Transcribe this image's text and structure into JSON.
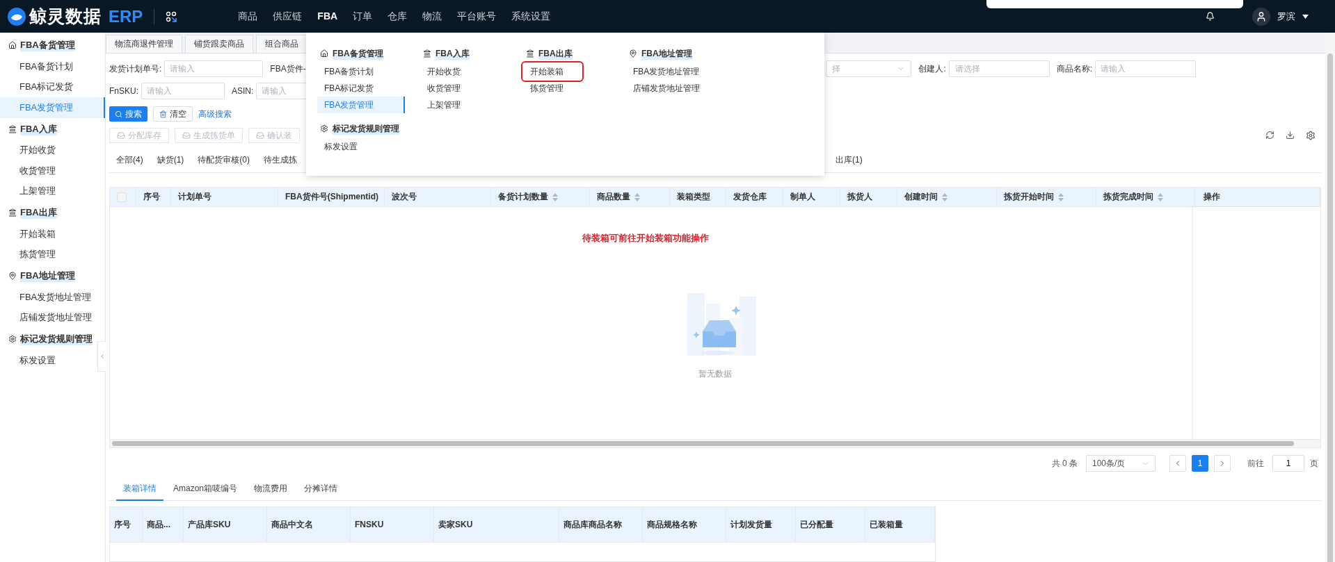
{
  "app": {
    "logo": "鲸灵数据",
    "logo_suffix": "ERP"
  },
  "top_nav": [
    {
      "label": "商品",
      "selected": false
    },
    {
      "label": "供应链",
      "selected": false
    },
    {
      "label": "FBA",
      "selected": true
    },
    {
      "label": "订单",
      "selected": false
    },
    {
      "label": "仓库",
      "selected": false
    },
    {
      "label": "物流",
      "selected": false
    },
    {
      "label": "平台账号",
      "selected": false
    },
    {
      "label": "系统设置",
      "selected": false
    }
  ],
  "user": {
    "name": "罗滨"
  },
  "sidebar": [
    {
      "title": "FBA备货管理",
      "kind": "home",
      "items": [
        {
          "label": "FBA备货计划",
          "selected": false
        },
        {
          "label": "FBA标记发货",
          "selected": false
        },
        {
          "label": "FBA发货管理",
          "selected": true
        }
      ]
    },
    {
      "title": "FBA入库",
      "kind": "bank",
      "items": [
        {
          "label": "开始收货",
          "selected": false
        },
        {
          "label": "收货管理",
          "selected": false
        },
        {
          "label": "上架管理",
          "selected": false
        }
      ]
    },
    {
      "title": "FBA出库",
      "kind": "bank",
      "items": [
        {
          "label": "开始装箱",
          "selected": false
        },
        {
          "label": "拣货管理",
          "selected": false
        }
      ]
    },
    {
      "title": "FBA地址管理",
      "kind": "pin",
      "items": [
        {
          "label": "FBA发货地址管理",
          "selected": false
        },
        {
          "label": "店铺发货地址管理",
          "selected": false
        }
      ]
    },
    {
      "title": "标记发货规则管理",
      "kind": "gear",
      "items": [
        {
          "label": "标发设置",
          "selected": false
        }
      ]
    }
  ],
  "page_tabs": [
    "物流商退件管理",
    "铺货跟卖商品",
    "组合商品"
  ],
  "filters_left": [
    [
      {
        "label": "发货计划单号:",
        "placeholder": "请输入"
      },
      {
        "label": "FBA货件-"
      }
    ],
    [
      {
        "label": "FnSKU:",
        "placeholder": "请输入"
      },
      {
        "label": "ASIN:",
        "placeholder": "请输入"
      }
    ]
  ],
  "filters_right": [
    {
      "kind": "select",
      "placeholder": "择"
    },
    {
      "kind": "select",
      "label": "创建人:",
      "placeholder": "请选择"
    },
    {
      "kind": "input",
      "label": "商品名称:",
      "placeholder": "请输入"
    }
  ],
  "search_buttons": {
    "search": "搜索",
    "clear": "清空",
    "advanced": "高级搜索"
  },
  "toolbar": [
    {
      "label": "分配库存",
      "disabled": true
    },
    {
      "label": "生成拣货单",
      "disabled": true
    },
    {
      "label": "确认装",
      "disabled": true
    }
  ],
  "status_tabs_left": [
    {
      "label": "全部(4)",
      "selected": false
    },
    {
      "label": "缺货(1)",
      "selected": false
    },
    {
      "label": "待配货审核(0)",
      "selected": false
    },
    {
      "label": "待生成拣",
      "selected": false
    }
  ],
  "status_tabs_right": [
    {
      "label": "出库(1)",
      "selected": false
    }
  ],
  "table": {
    "columns": [
      {
        "label": "序号",
        "sortable": false
      },
      {
        "label": "计划单号",
        "sortable": false
      },
      {
        "label": "FBA货件号(Shipmentid)",
        "sortable": false
      },
      {
        "label": "波次号",
        "sortable": false
      },
      {
        "label": "备货计划数量",
        "sortable": true
      },
      {
        "label": "商品数量",
        "sortable": true
      },
      {
        "label": "装箱类型",
        "sortable": false
      },
      {
        "label": "发货仓库",
        "sortable": false
      },
      {
        "label": "制单人",
        "sortable": false
      },
      {
        "label": "拣货人",
        "sortable": false
      },
      {
        "label": "创建时间",
        "sortable": true
      },
      {
        "label": "拣货开始时间",
        "sortable": true
      },
      {
        "label": "拣货完成时间",
        "sortable": true
      },
      {
        "label": "操作",
        "sortable": false
      }
    ],
    "select_all_checked": false,
    "notice": "待装箱可前往开始装箱功能操作",
    "empty_text": "暂无数据"
  },
  "pagination": {
    "total": "共 0 条",
    "page_size": "100条/页",
    "pages": [
      {
        "label": "1",
        "selected": true
      }
    ],
    "goto_label": "前往",
    "goto_value": "1",
    "goto_suffix": "页"
  },
  "detail_tabs": [
    {
      "label": "装箱详情",
      "selected": true
    },
    {
      "label": "Amazon箱唛编号",
      "selected": false
    },
    {
      "label": "物流费用",
      "selected": false
    },
    {
      "label": "分摊详情",
      "selected": false
    }
  ],
  "detail_table": {
    "columns": [
      "序号",
      "商品...",
      "产品库SKU",
      "商品中文名",
      "FNSKU",
      "卖家SKU",
      "商品库商品名称",
      "商品规格名称",
      "计划发货量",
      "已分配量",
      "已装箱量"
    ]
  },
  "dropdown": [
    {
      "columns": [
        {
          "title": "FBA备货管理",
          "kind": "home",
          "items": [
            {
              "label": "FBA备货计划",
              "selected": false,
              "highlighted": false
            },
            {
              "label": "FBA标记发货",
              "selected": false,
              "highlighted": false
            },
            {
              "label": "FBA发货管理",
              "selected": true,
              "highlighted": false
            }
          ]
        },
        {
          "title": "FBA入库",
          "kind": "bank",
          "items": [
            {
              "label": "开始收货",
              "selected": false,
              "highlighted": false
            },
            {
              "label": "收货管理",
              "selected": false,
              "highlighted": false
            },
            {
              "label": "上架管理",
              "selected": false,
              "highlighted": false
            }
          ]
        },
        {
          "title": "FBA出库",
          "kind": "bank",
          "items": [
            {
              "label": "开始装箱",
              "selected": false,
              "highlighted": true
            },
            {
              "label": "拣货管理",
              "selected": false,
              "highlighted": false
            }
          ]
        },
        {
          "title": "FBA地址管理",
          "kind": "pin",
          "items": [
            {
              "label": "FBA发货地址管理",
              "selected": false,
              "highlighted": false
            },
            {
              "label": "店铺发货地址管理",
              "selected": false,
              "highlighted": false
            }
          ]
        }
      ]
    },
    {
      "columns": [
        {
          "title": "标记发货规则管理",
          "kind": "gear",
          "items": [
            {
              "label": "标发设置",
              "selected": false,
              "highlighted": false
            }
          ]
        }
      ]
    }
  ]
}
